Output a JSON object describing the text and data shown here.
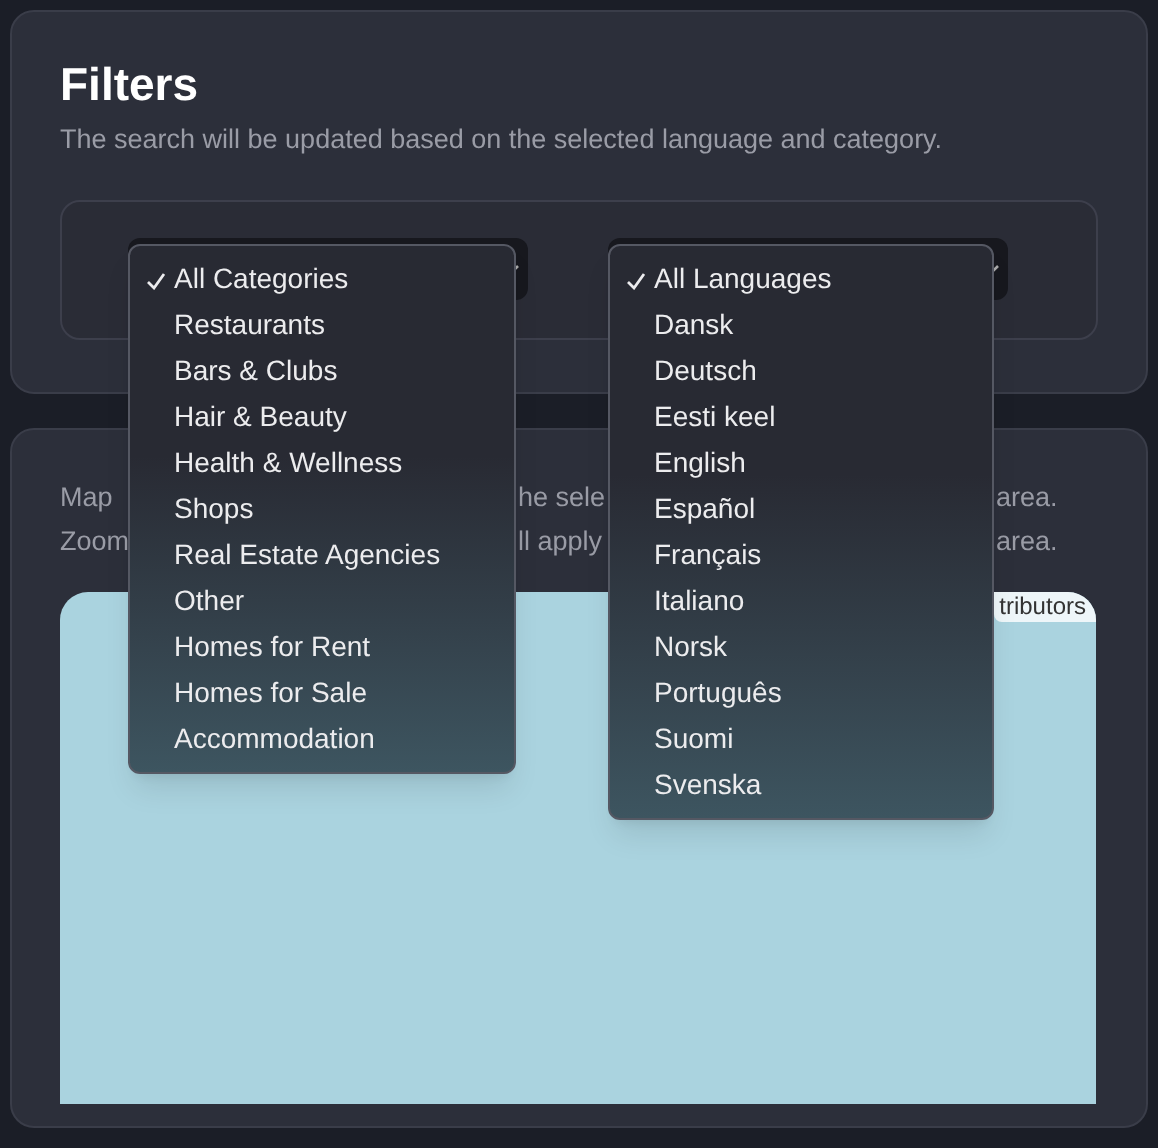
{
  "filters": {
    "title": "Filters",
    "description": "The search will be updated based on the selected language and category."
  },
  "category_menu": {
    "items": [
      {
        "label": "All Categories",
        "selected": true
      },
      {
        "label": "Restaurants",
        "selected": false
      },
      {
        "label": "Bars & Clubs",
        "selected": false
      },
      {
        "label": "Hair & Beauty",
        "selected": false
      },
      {
        "label": "Health & Wellness",
        "selected": false
      },
      {
        "label": "Shops",
        "selected": false
      },
      {
        "label": "Real Estate Agencies",
        "selected": false
      },
      {
        "label": "Other",
        "selected": false
      },
      {
        "label": "Homes for Rent",
        "selected": false
      },
      {
        "label": "Homes for Sale",
        "selected": false
      },
      {
        "label": "Accommodation",
        "selected": false
      }
    ]
  },
  "language_menu": {
    "items": [
      {
        "label": "All Languages",
        "selected": true
      },
      {
        "label": "Dansk",
        "selected": false
      },
      {
        "label": "Deutsch",
        "selected": false
      },
      {
        "label": "Eesti keel",
        "selected": false
      },
      {
        "label": "English",
        "selected": false
      },
      {
        "label": "Español",
        "selected": false
      },
      {
        "label": "Français",
        "selected": false
      },
      {
        "label": "Italiano",
        "selected": false
      },
      {
        "label": "Norsk",
        "selected": false
      },
      {
        "label": "Português",
        "selected": false
      },
      {
        "label": "Suomi",
        "selected": false
      },
      {
        "label": "Svenska",
        "selected": false
      }
    ]
  },
  "map_section": {
    "description_lines": [
      [
        "Map",
        "he sele",
        "area."
      ],
      [
        "Zoom",
        "ll apply",
        "area."
      ]
    ],
    "attribution": "tributors"
  }
}
